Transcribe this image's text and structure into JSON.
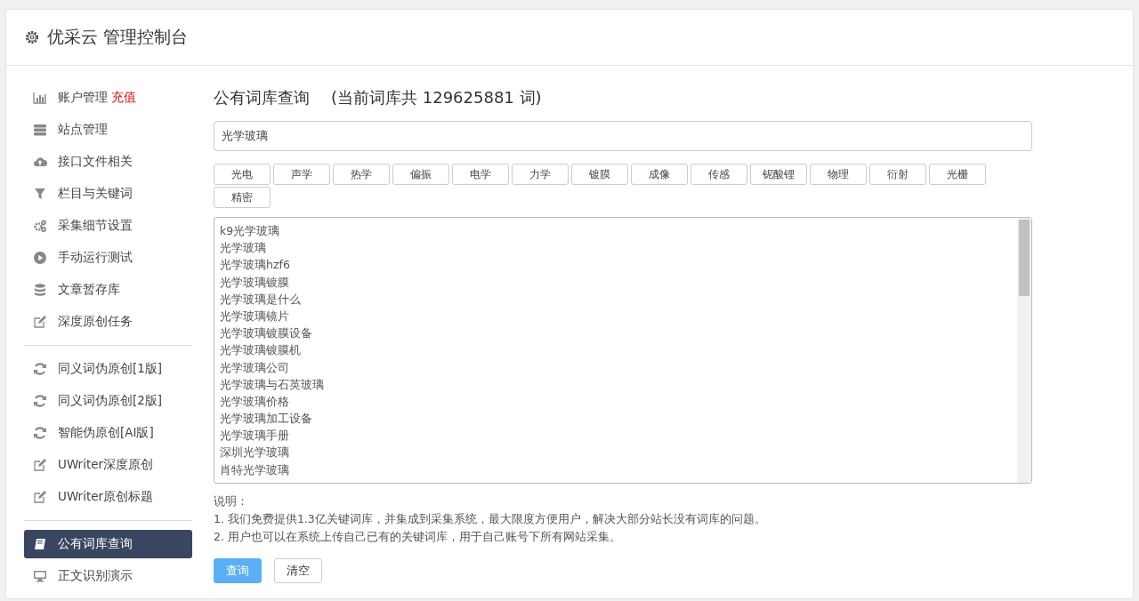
{
  "header": {
    "title": "优采云 管理控制台"
  },
  "sidebar": {
    "groups": [
      [
        {
          "label": "账户管理",
          "badge": "充值",
          "selected": false
        },
        {
          "label": "站点管理",
          "selected": false
        },
        {
          "label": "接口文件相关",
          "selected": false
        },
        {
          "label": "栏目与关键词",
          "selected": false
        },
        {
          "label": "采集细节设置",
          "selected": false
        },
        {
          "label": "手动运行测试",
          "selected": false
        },
        {
          "label": "文章暂存库",
          "selected": false
        },
        {
          "label": "深度原创任务",
          "selected": false
        }
      ],
      [
        {
          "label": "同义词伪原创[1版]",
          "selected": false
        },
        {
          "label": "同义词伪原创[2版]",
          "selected": false
        },
        {
          "label": "智能伪原创[AI版]",
          "selected": false
        },
        {
          "label": "UWriter深度原创",
          "selected": false
        },
        {
          "label": "UWriter原创标题",
          "selected": false
        }
      ],
      [
        {
          "label": "公有词库查询",
          "selected": true
        },
        {
          "label": "正文识别演示",
          "selected": false
        }
      ]
    ]
  },
  "main": {
    "title": "公有词库查询",
    "count_note": "(当前词库共 129625881 词)",
    "search": {
      "value": "光学玻璃"
    },
    "tags": [
      "光电",
      "声学",
      "热学",
      "偏振",
      "电学",
      "力学",
      "镀膜",
      "成像",
      "传感",
      "铌酸锂",
      "物理",
      "衍射",
      "光栅",
      "精密"
    ],
    "results": [
      "k9光学玻璃",
      "光学玻璃",
      "光学玻璃hzf6",
      "光学玻璃镀膜",
      "光学玻璃是什么",
      "光学玻璃镜片",
      "光学玻璃镀膜设备",
      "光学玻璃镀膜机",
      "光学玻璃公司",
      "光学玻璃与石英玻璃",
      "光学玻璃价格",
      "光学玻璃加工设备",
      "光学玻璃手册",
      "深圳光学玻璃",
      "肖特光学玻璃"
    ],
    "notes_title": "说明：",
    "notes": [
      "1. 我们免费提供1.3亿关键词库，并集成到采集系统，最大限度方便用户，解决大部分站长没有词库的问题。",
      "2. 用户也可以在系统上传自己已有的关键词库，用于自己账号下所有网站采集。"
    ],
    "buttons": [
      {
        "label": "查询",
        "kind": "primary"
      },
      {
        "label": "清空",
        "kind": "default"
      }
    ]
  }
}
